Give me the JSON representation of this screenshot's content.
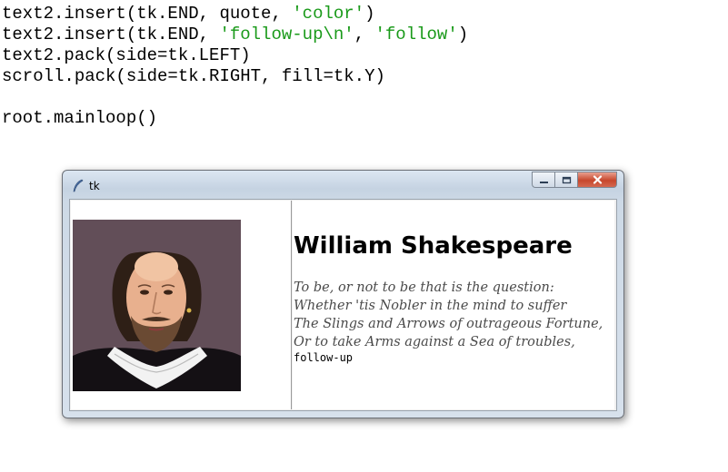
{
  "code": {
    "line1": {
      "pre": "text2.insert(tk.END, quote, ",
      "s1": "'color'",
      "post": ")"
    },
    "line2": {
      "pre": "text2.insert(tk.END, ",
      "s1": "'follow-up\\n'",
      "mid": ", ",
      "s2": "'follow'",
      "post": ")"
    },
    "line3": "text2.pack(side=tk.LEFT)",
    "line4": "scroll.pack(side=tk.RIGHT, fill=tk.Y)",
    "line5": "",
    "line6": "root.mainloop()"
  },
  "window": {
    "title": "tk",
    "icon": "feather-icon",
    "controls": {
      "minimize": "minimize-icon",
      "maximize": "maximize-icon",
      "close": "close-icon"
    }
  },
  "content": {
    "image": "shakespeare-portrait",
    "heading": "William Shakespeare",
    "quote_lines": [
      "To be, or not to be that is the question:",
      "Whether 'tis Nobler in the mind to suffer",
      "The Slings and Arrows of outrageous Fortune,",
      "Or to take Arms against a Sea of troubles,"
    ],
    "followup": "follow-up"
  },
  "colors": {
    "code_string": "#1a9a1a",
    "quote_text": "#4a4a4a",
    "close_button": "#c7472c"
  }
}
